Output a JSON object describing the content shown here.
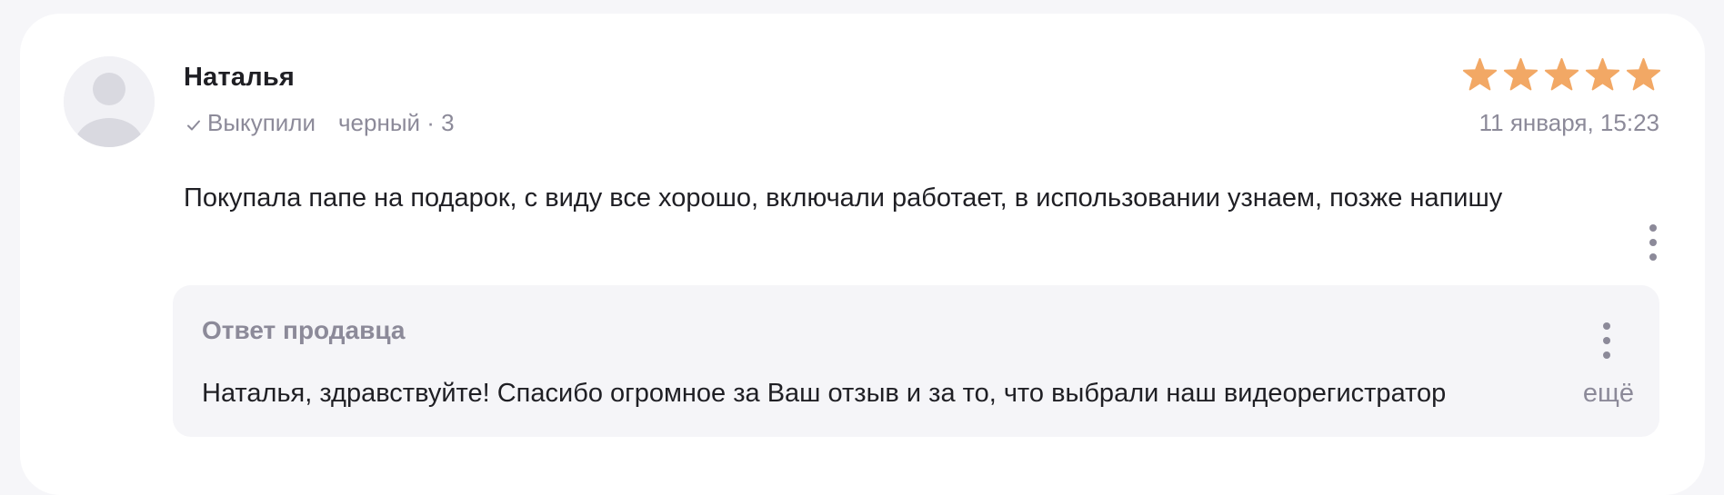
{
  "review": {
    "author": "Наталья",
    "bought_label": "Выкупили",
    "variant": "черный · 3",
    "rating": 5,
    "rating_max": 5,
    "star_color": "#f2a865",
    "date": "11 января, 15:23",
    "text": "Покупала папе на подарок, с виду все хорошо, включали работает, в использовании узнаем, позже напишу"
  },
  "seller_reply": {
    "title": "Ответ продавца",
    "text": "Наталья, здравствуйте! Спасибо огромное за Ваш отзыв и за то, что выбрали наш видеорегистратор",
    "more_label": "ещё"
  },
  "icons": {
    "verified": "check-icon",
    "rating": "star-icon",
    "menu": "more-vertical-icon",
    "avatar": "user-placeholder-icon"
  }
}
